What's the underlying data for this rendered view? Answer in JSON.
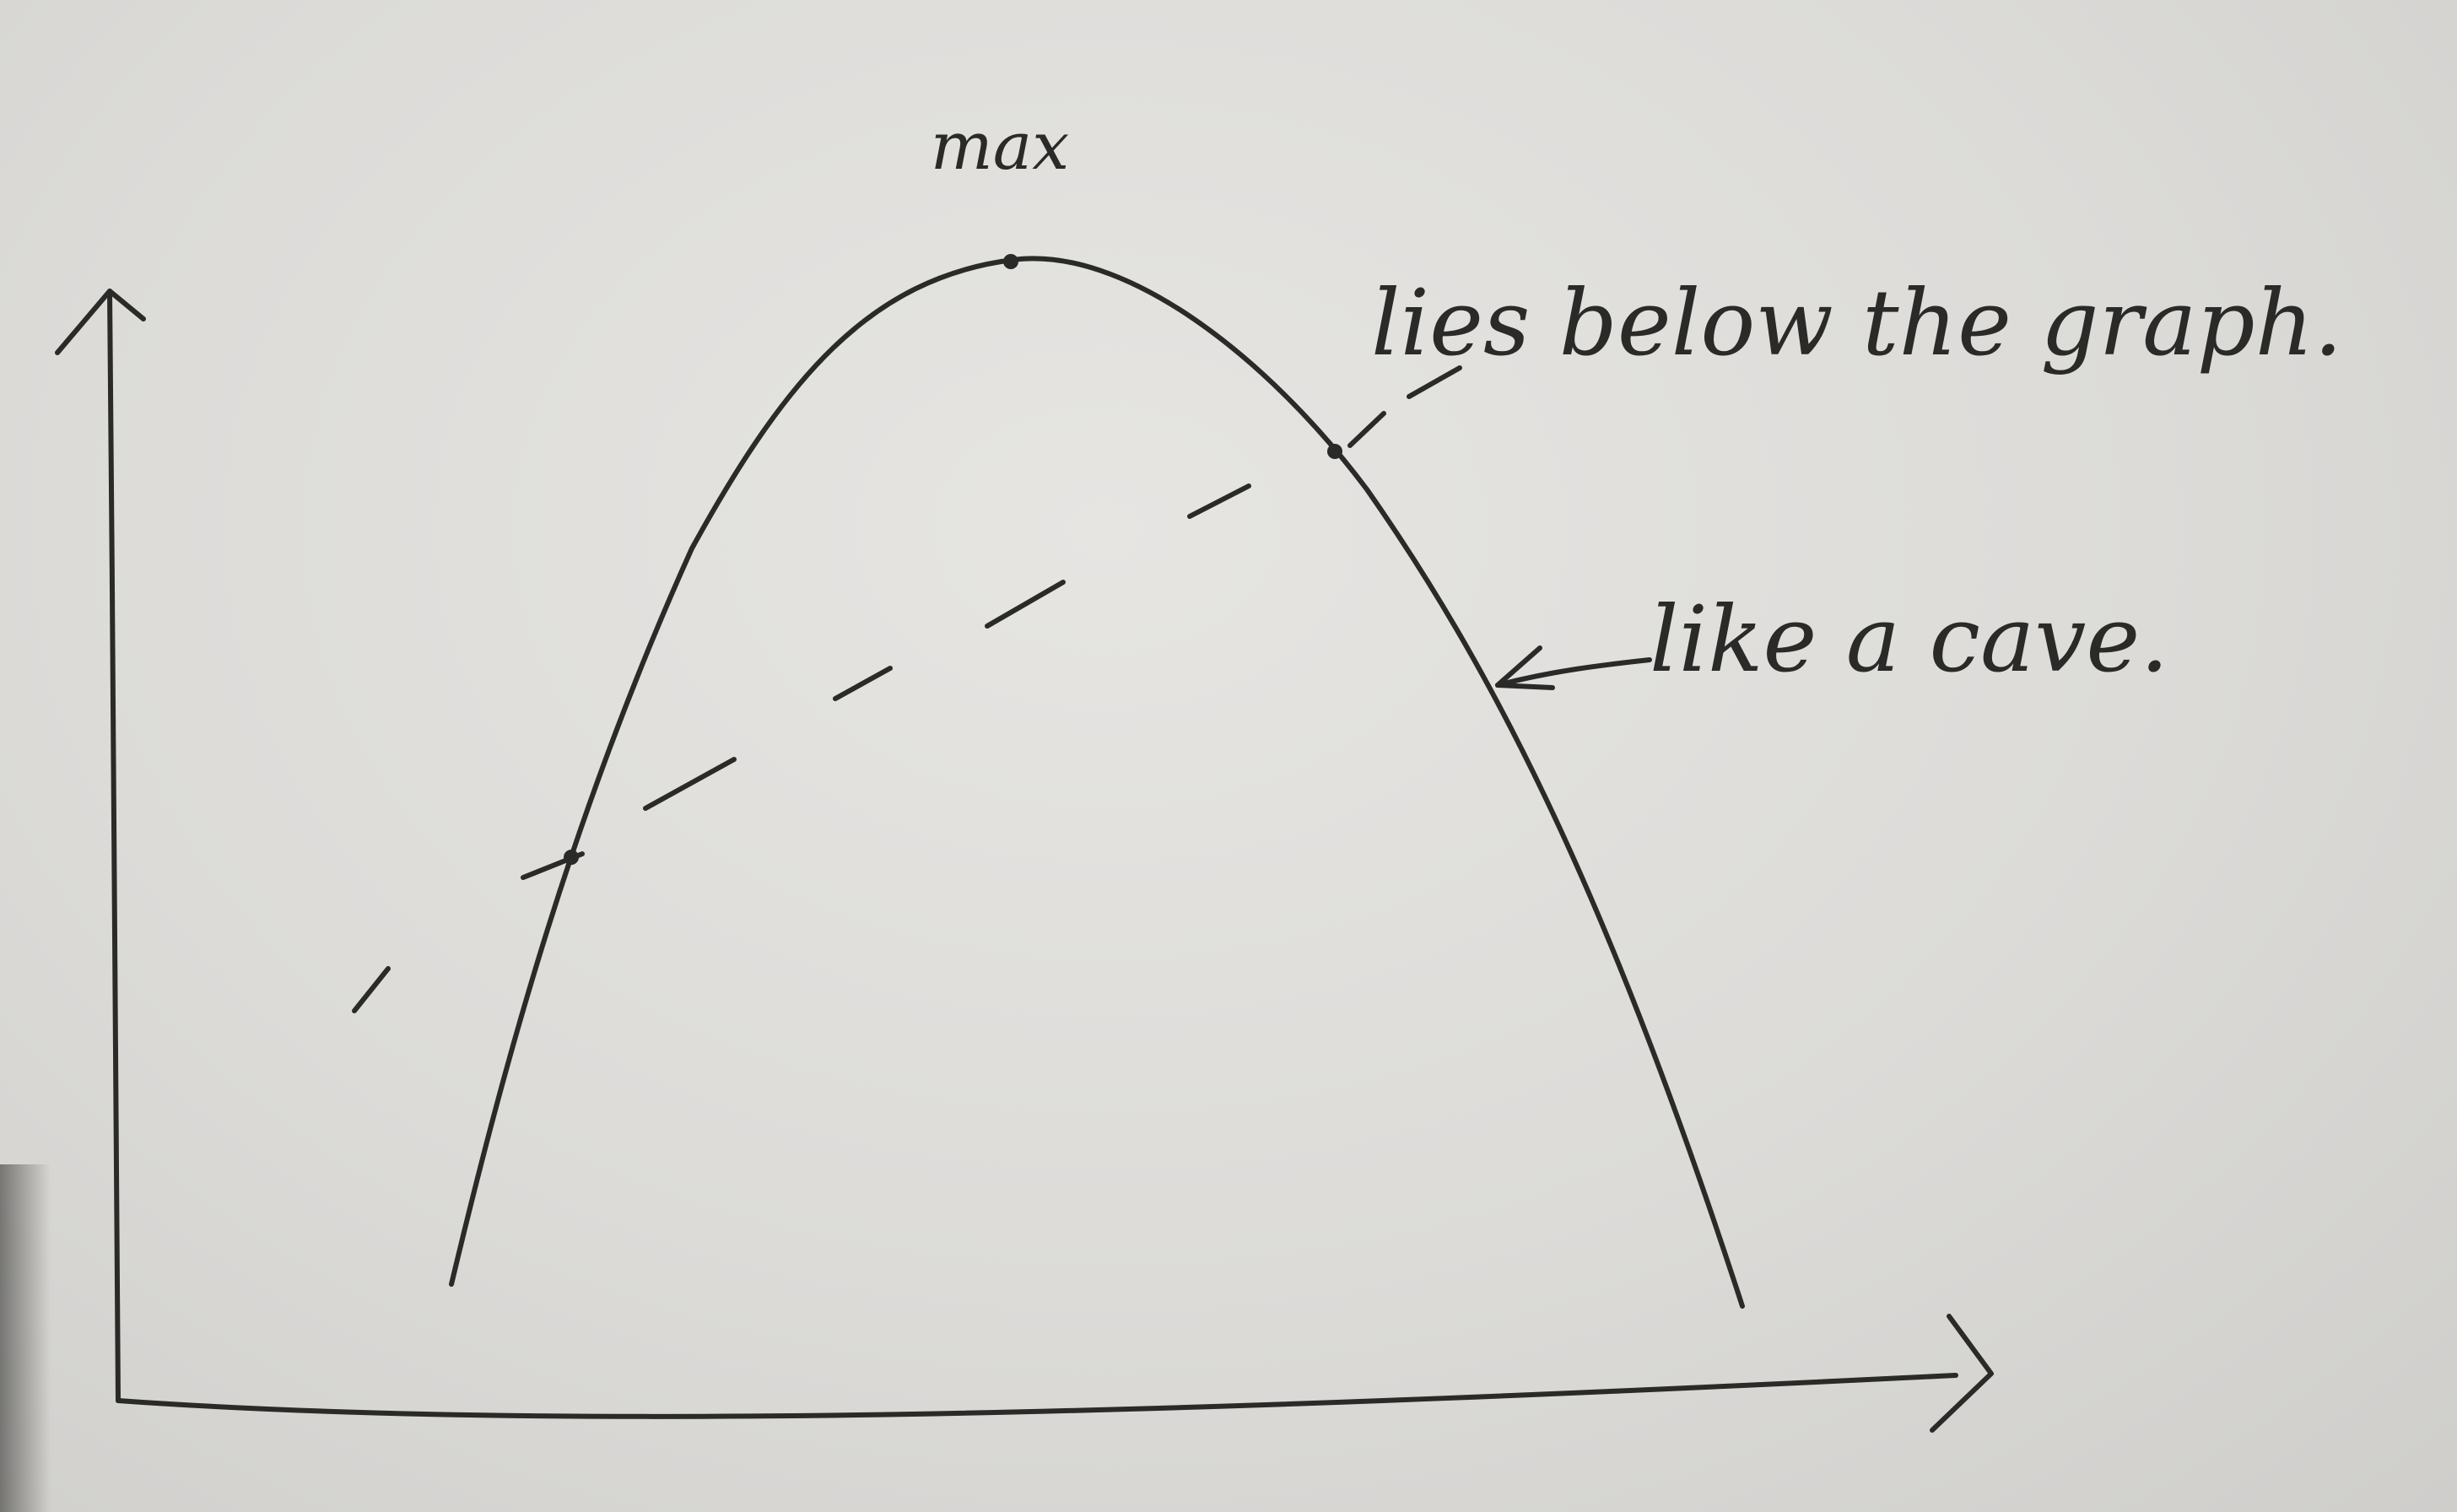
{
  "annotations": {
    "max": "max",
    "lies_below": "lies below the graph.",
    "like_cave": "like a cave."
  },
  "colors": {
    "paper": "#dcdbd8",
    "ink": "#2a2a28"
  }
}
